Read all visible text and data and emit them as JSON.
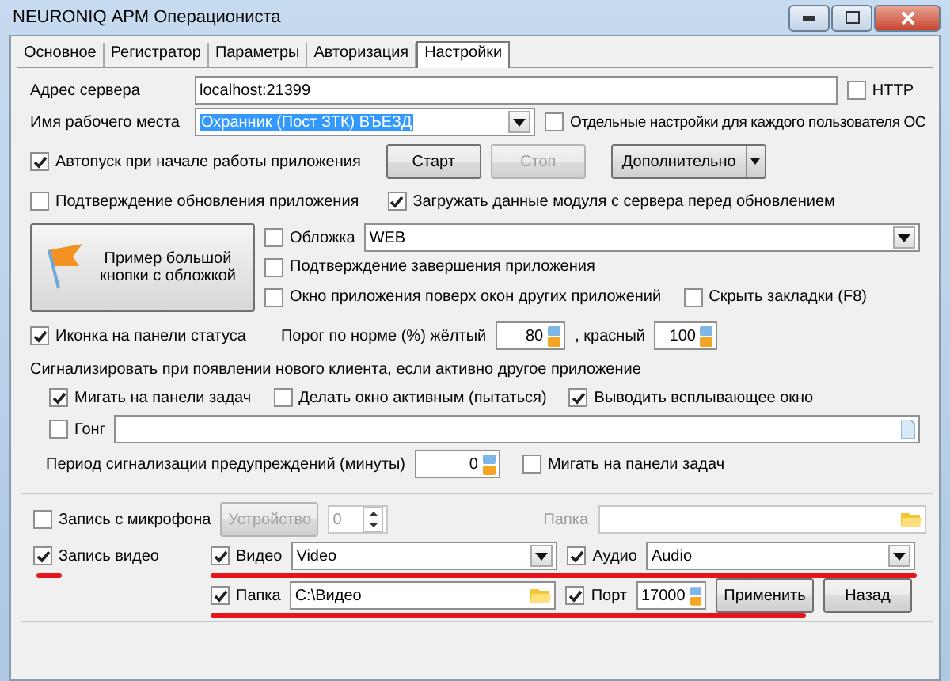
{
  "window": {
    "title": "NEURONIQ АРМ Операциониста"
  },
  "tabs": [
    {
      "label": "Основное",
      "selected": false
    },
    {
      "label": "Регистратор",
      "selected": false
    },
    {
      "label": "Параметры",
      "selected": false
    },
    {
      "label": "Авторизация",
      "selected": false
    },
    {
      "label": "Настройки",
      "selected": true
    }
  ],
  "server": {
    "label": "Адрес сервера",
    "value": "localhost:21399",
    "http": {
      "label": "HTTP",
      "checked": false
    }
  },
  "workplace": {
    "label": "Имя рабочего места",
    "value": "Охранник (Пост ЗТК) ВЪЕЗД",
    "per_user": {
      "label": "Отдельные настройки для каждого пользователя ОС",
      "checked": false
    }
  },
  "autostart": {
    "label": "Автопуск при начале работы приложения",
    "checked": true
  },
  "buttons": [
    {
      "label": "Старт",
      "disabled": false
    },
    {
      "label": "Стоп",
      "disabled": true
    }
  ],
  "more_button": {
    "label": "Дополнительно"
  },
  "confirm_update": {
    "label": "Подтверждение обновления приложения",
    "checked": false
  },
  "load_module": {
    "label": "Загружать данные модуля с сервера перед обновлением",
    "checked": true
  },
  "big_button": {
    "label": "Пример большой кнопки с обложкой"
  },
  "cover": {
    "label": "Обложка",
    "checked": false,
    "value": "WEB"
  },
  "confirm_exit": {
    "label": "Подтверждение завершения приложения",
    "checked": false
  },
  "on_top": {
    "label": "Окно приложения поверх окон других приложений",
    "checked": false
  },
  "hide_tabs": {
    "label": "Скрыть закладки (F8)",
    "checked": false
  },
  "status_icon": {
    "label": "Иконка на панели статуса",
    "checked": true
  },
  "threshold": {
    "label": "Порог по норме (%) жёлтый",
    "yellow": "80",
    "red_label": ", красный",
    "red": "100"
  },
  "signal": {
    "title": "Сигнализировать при появлении нового клиента, если активно другое приложение",
    "options": [
      {
        "label": "Мигать на панели задач",
        "checked": true
      },
      {
        "label": "Делать окно активным (пытаться)",
        "checked": false
      },
      {
        "label": "Выводить всплывающее окно",
        "checked": true
      }
    ],
    "gong": {
      "label": "Гонг",
      "checked": false
    }
  },
  "period": {
    "label": "Период сигнализации предупреждений (минуты)",
    "value": "0",
    "blink": {
      "label": "Мигать на панели задач",
      "checked": false
    }
  },
  "recording": {
    "mic": {
      "label": "Запись с микрофона",
      "checked": false
    },
    "device_button": {
      "label": "Устройство",
      "disabled": true
    },
    "mic_value": "0",
    "mic_folder": {
      "label": "Папка",
      "disabled": true
    },
    "video": {
      "label": "Запись видео",
      "checked": true
    },
    "video_source": {
      "label": "Видео",
      "checked": true,
      "value": "Video"
    },
    "audio_source": {
      "label": "Аудио",
      "checked": true,
      "value": "Audio"
    },
    "folder": {
      "label": "Папка",
      "checked": true,
      "value": "C:\\Видео"
    },
    "port": {
      "label": "Порт",
      "checked": true,
      "value": "17000"
    },
    "apply": {
      "label": "Применить"
    },
    "back": {
      "label": "Назад"
    }
  }
}
